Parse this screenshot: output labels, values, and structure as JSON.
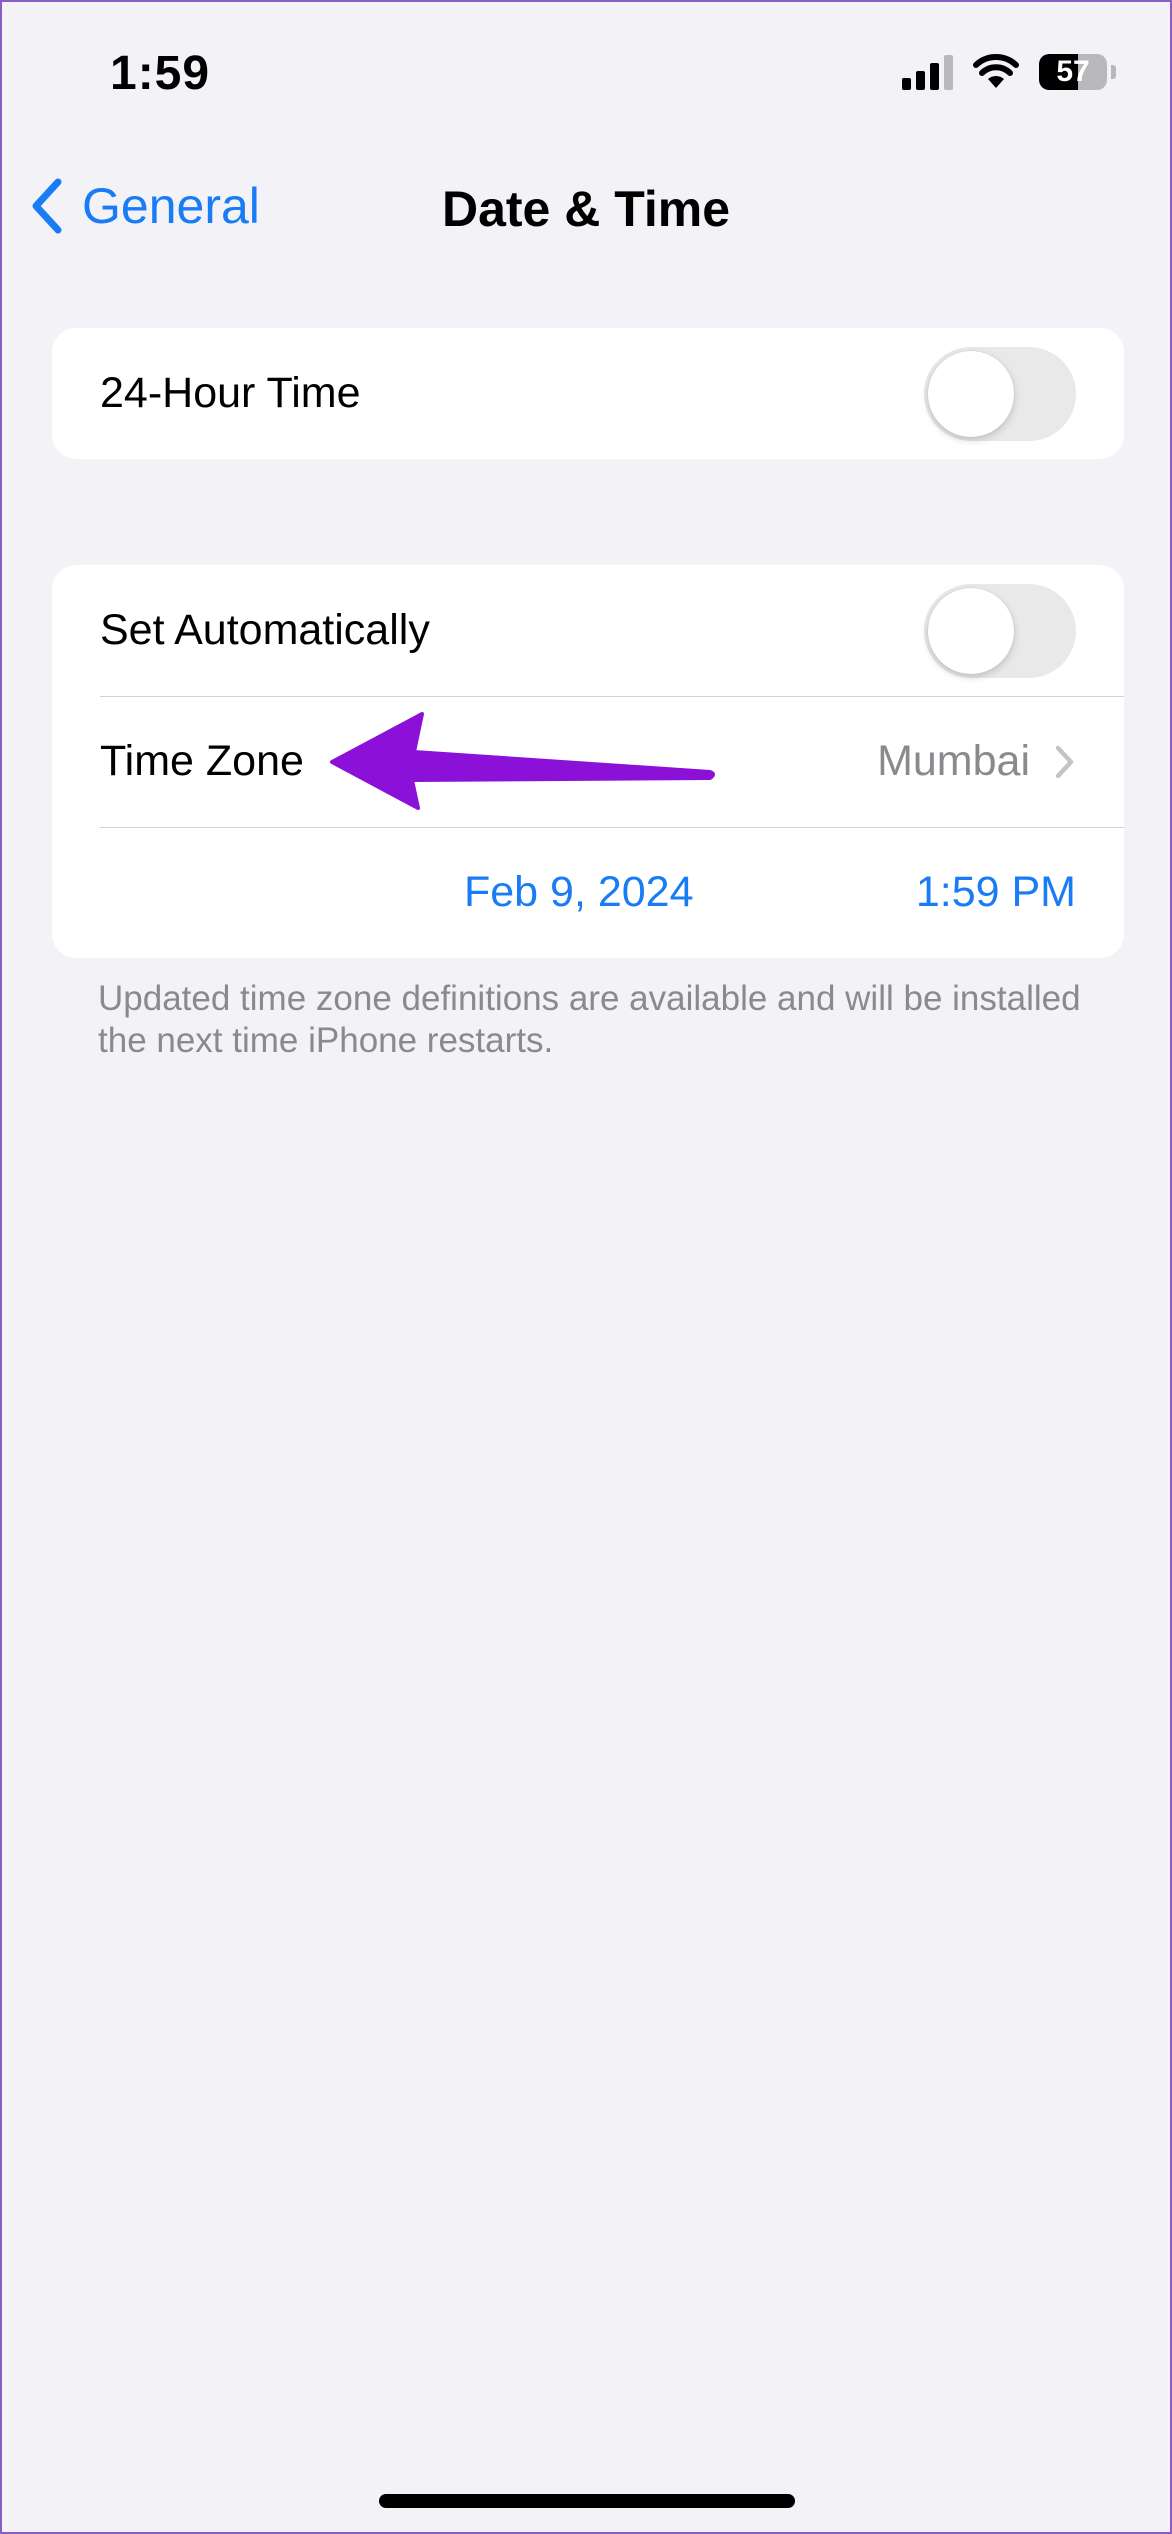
{
  "status_bar": {
    "time": "1:59",
    "battery_percent": "57",
    "battery_level": 0.57
  },
  "nav": {
    "back_label": "General",
    "title": "Date & Time"
  },
  "group1": {
    "hour24_label": "24-Hour Time",
    "hour24_on": false
  },
  "group2": {
    "set_auto_label": "Set Automatically",
    "set_auto_on": false,
    "timezone_label": "Time Zone",
    "timezone_value": "Mumbai",
    "date": "Feb 9, 2024",
    "time": "1:59 PM"
  },
  "footer_note": "Updated time zone definitions are available and will be installed the next time iPhone restarts.",
  "colors": {
    "accent": "#1a7cf4",
    "annotation_arrow": "#8b10d8",
    "background": "#f2f2f7"
  },
  "icons": {
    "back": "chevron-left-icon",
    "disclosure": "chevron-right-icon",
    "signal": "cellular-signal-icon",
    "wifi": "wifi-icon",
    "battery": "battery-icon",
    "annotation": "arrow-left-icon"
  }
}
